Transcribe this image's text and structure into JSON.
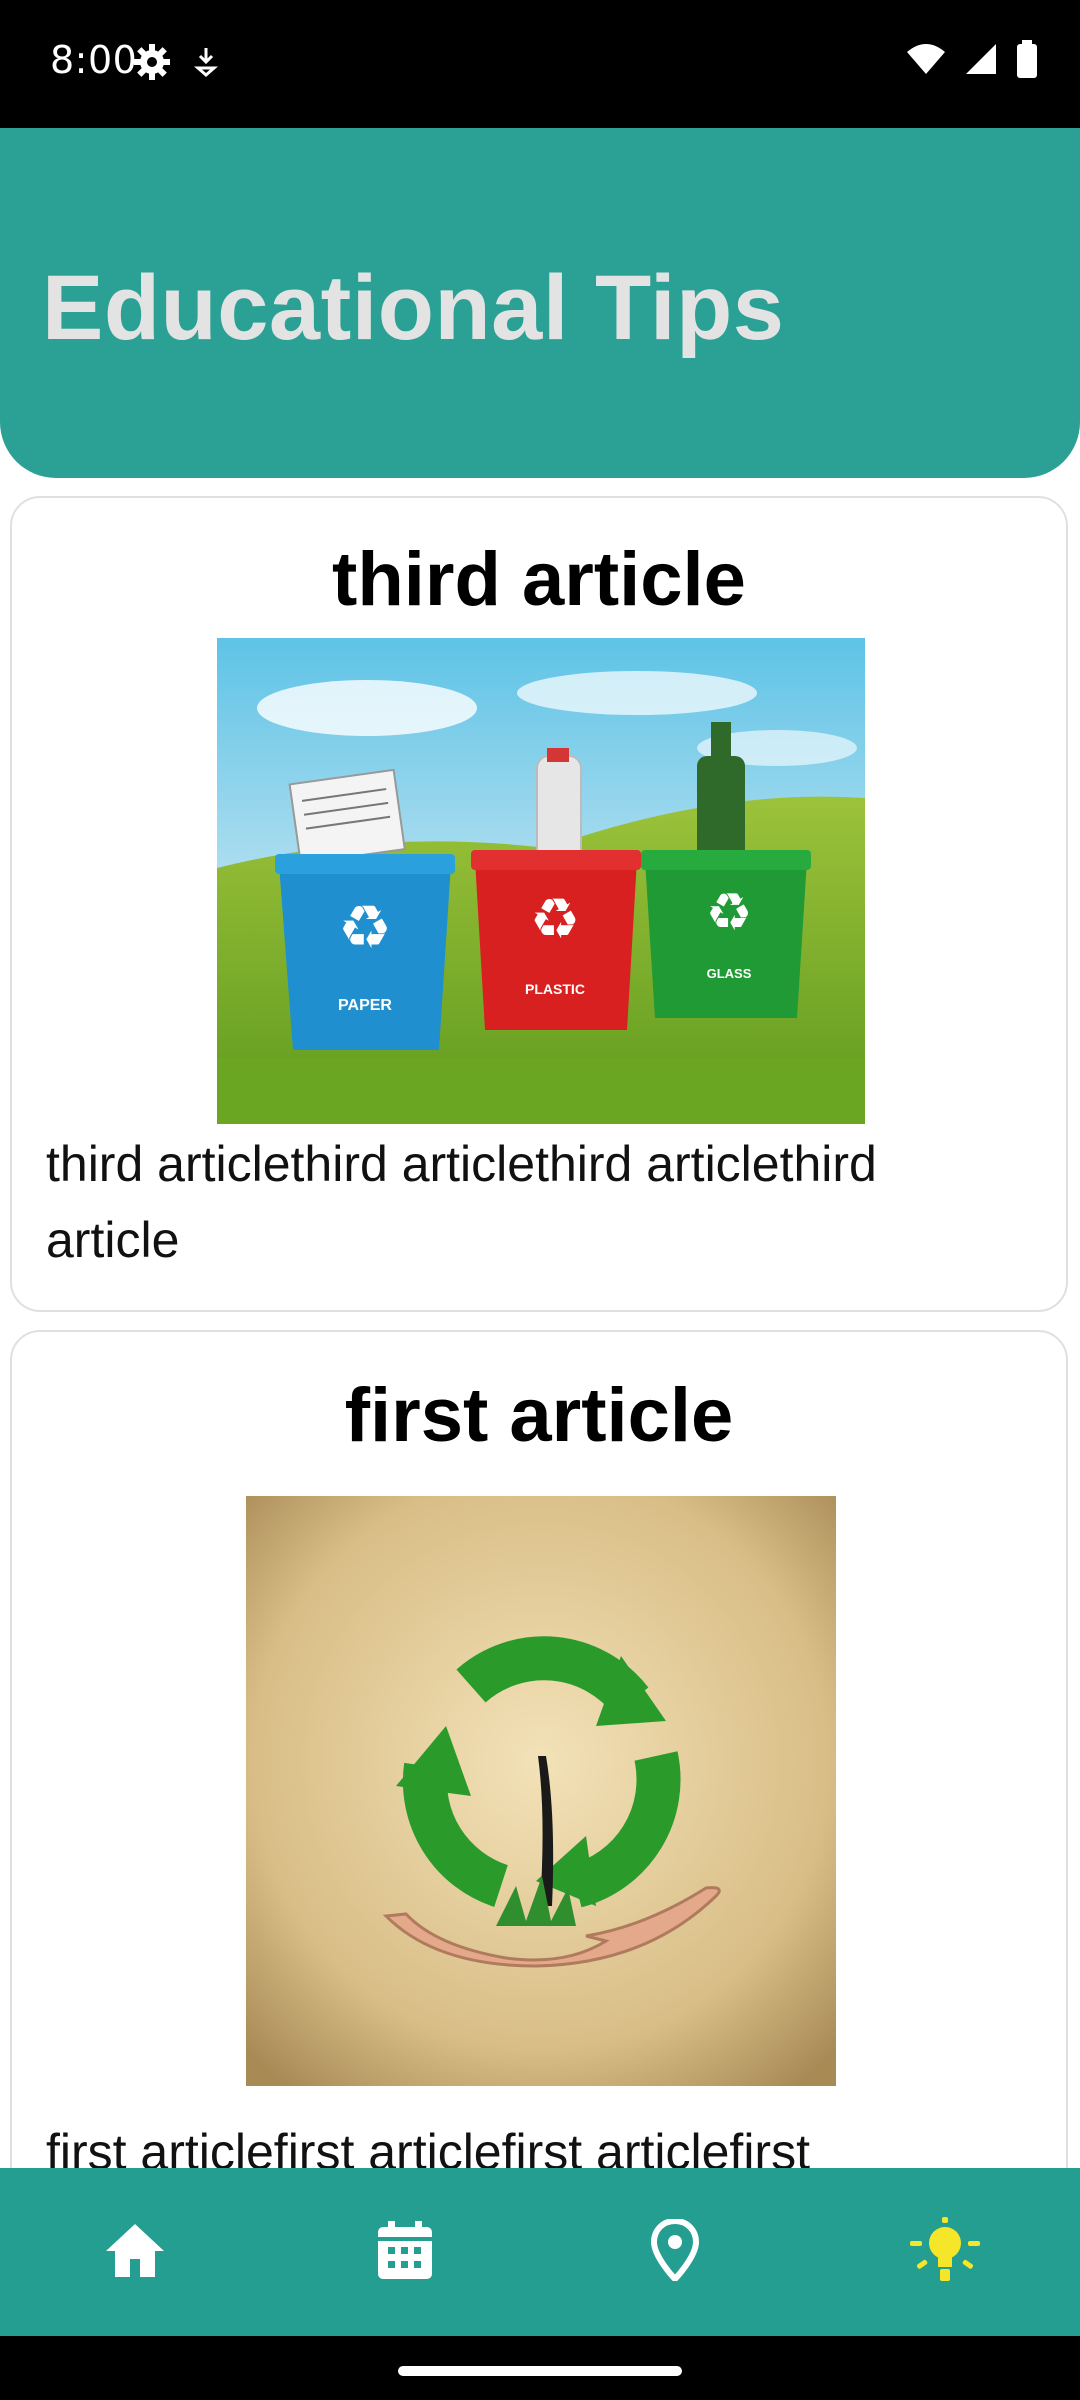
{
  "status_bar": {
    "time": "8:00",
    "left_icons": [
      "settings-gear-icon",
      "download-arrow-icon"
    ],
    "right_icons": [
      "wifi-icon",
      "signal-icon",
      "battery-icon"
    ]
  },
  "header": {
    "title": "Educational Tips",
    "background_color": "#2aa194",
    "title_color": "#e3e3e3"
  },
  "articles": [
    {
      "title": "third article",
      "image": "recycling-bins-image",
      "image_bin_labels": [
        "PAPER",
        "PLASTIC",
        "GLASS"
      ],
      "body": "third articlethird articlethird articlethird article"
    },
    {
      "title": "first article",
      "image": "recycle-tree-hand-image",
      "body": "first articlefirst articlefirst articlefirst"
    }
  ],
  "bottom_nav": {
    "background_color": "#239e90",
    "items": [
      {
        "icon": "home-icon",
        "active": false
      },
      {
        "icon": "calendar-icon",
        "active": false
      },
      {
        "icon": "map-pin-icon",
        "active": false
      },
      {
        "icon": "lightbulb-icon",
        "active": true
      }
    ],
    "active_color": "#f5e62a",
    "inactive_color": "#ffffff"
  }
}
